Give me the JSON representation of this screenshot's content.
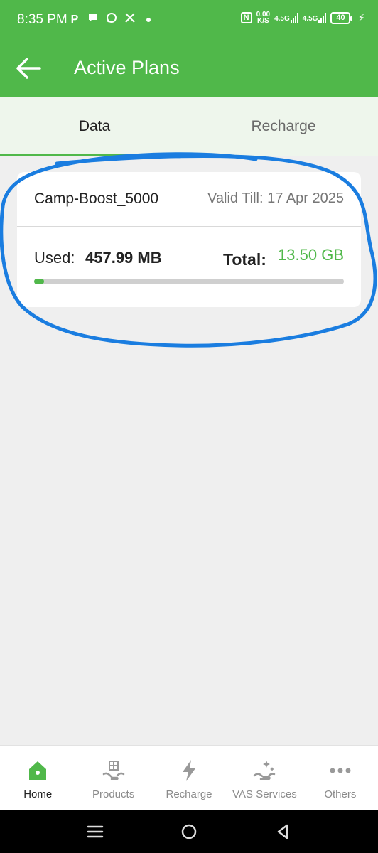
{
  "status_bar": {
    "time": "8:35 PM",
    "notif_icons": [
      "P",
      "chat-icon",
      "whatsapp-icon",
      "x-icon",
      "dot-icon"
    ],
    "net_speed": "0.00",
    "net_unit": "K/S",
    "sim1": "4.5G",
    "sim2": "4.5G",
    "battery": "40"
  },
  "appbar": {
    "title": "Active Plans"
  },
  "tabs": [
    {
      "label": "Data",
      "active": true
    },
    {
      "label": "Recharge",
      "active": false
    }
  ],
  "plan": {
    "name": "Camp-Boost_5000",
    "valid_till": "Valid Till: 17 Apr 2025",
    "used_label": "Used:",
    "used_value": "457.99 MB",
    "total_label": "Total:",
    "total_value": "13.50 GB",
    "usage_fraction": 0.033
  },
  "bottom_nav": [
    {
      "label": "Home",
      "icon": "home-icon",
      "active": true
    },
    {
      "label": "Products",
      "icon": "products-icon",
      "active": false
    },
    {
      "label": "Recharge",
      "icon": "lightning-icon",
      "active": false
    },
    {
      "label": "VAS Services",
      "icon": "vas-icon",
      "active": false
    },
    {
      "label": "Others",
      "icon": "more-icon",
      "active": false
    }
  ],
  "colors": {
    "brand": "#50b84a",
    "annotation": "#1a7de0",
    "background": "#efefef"
  }
}
